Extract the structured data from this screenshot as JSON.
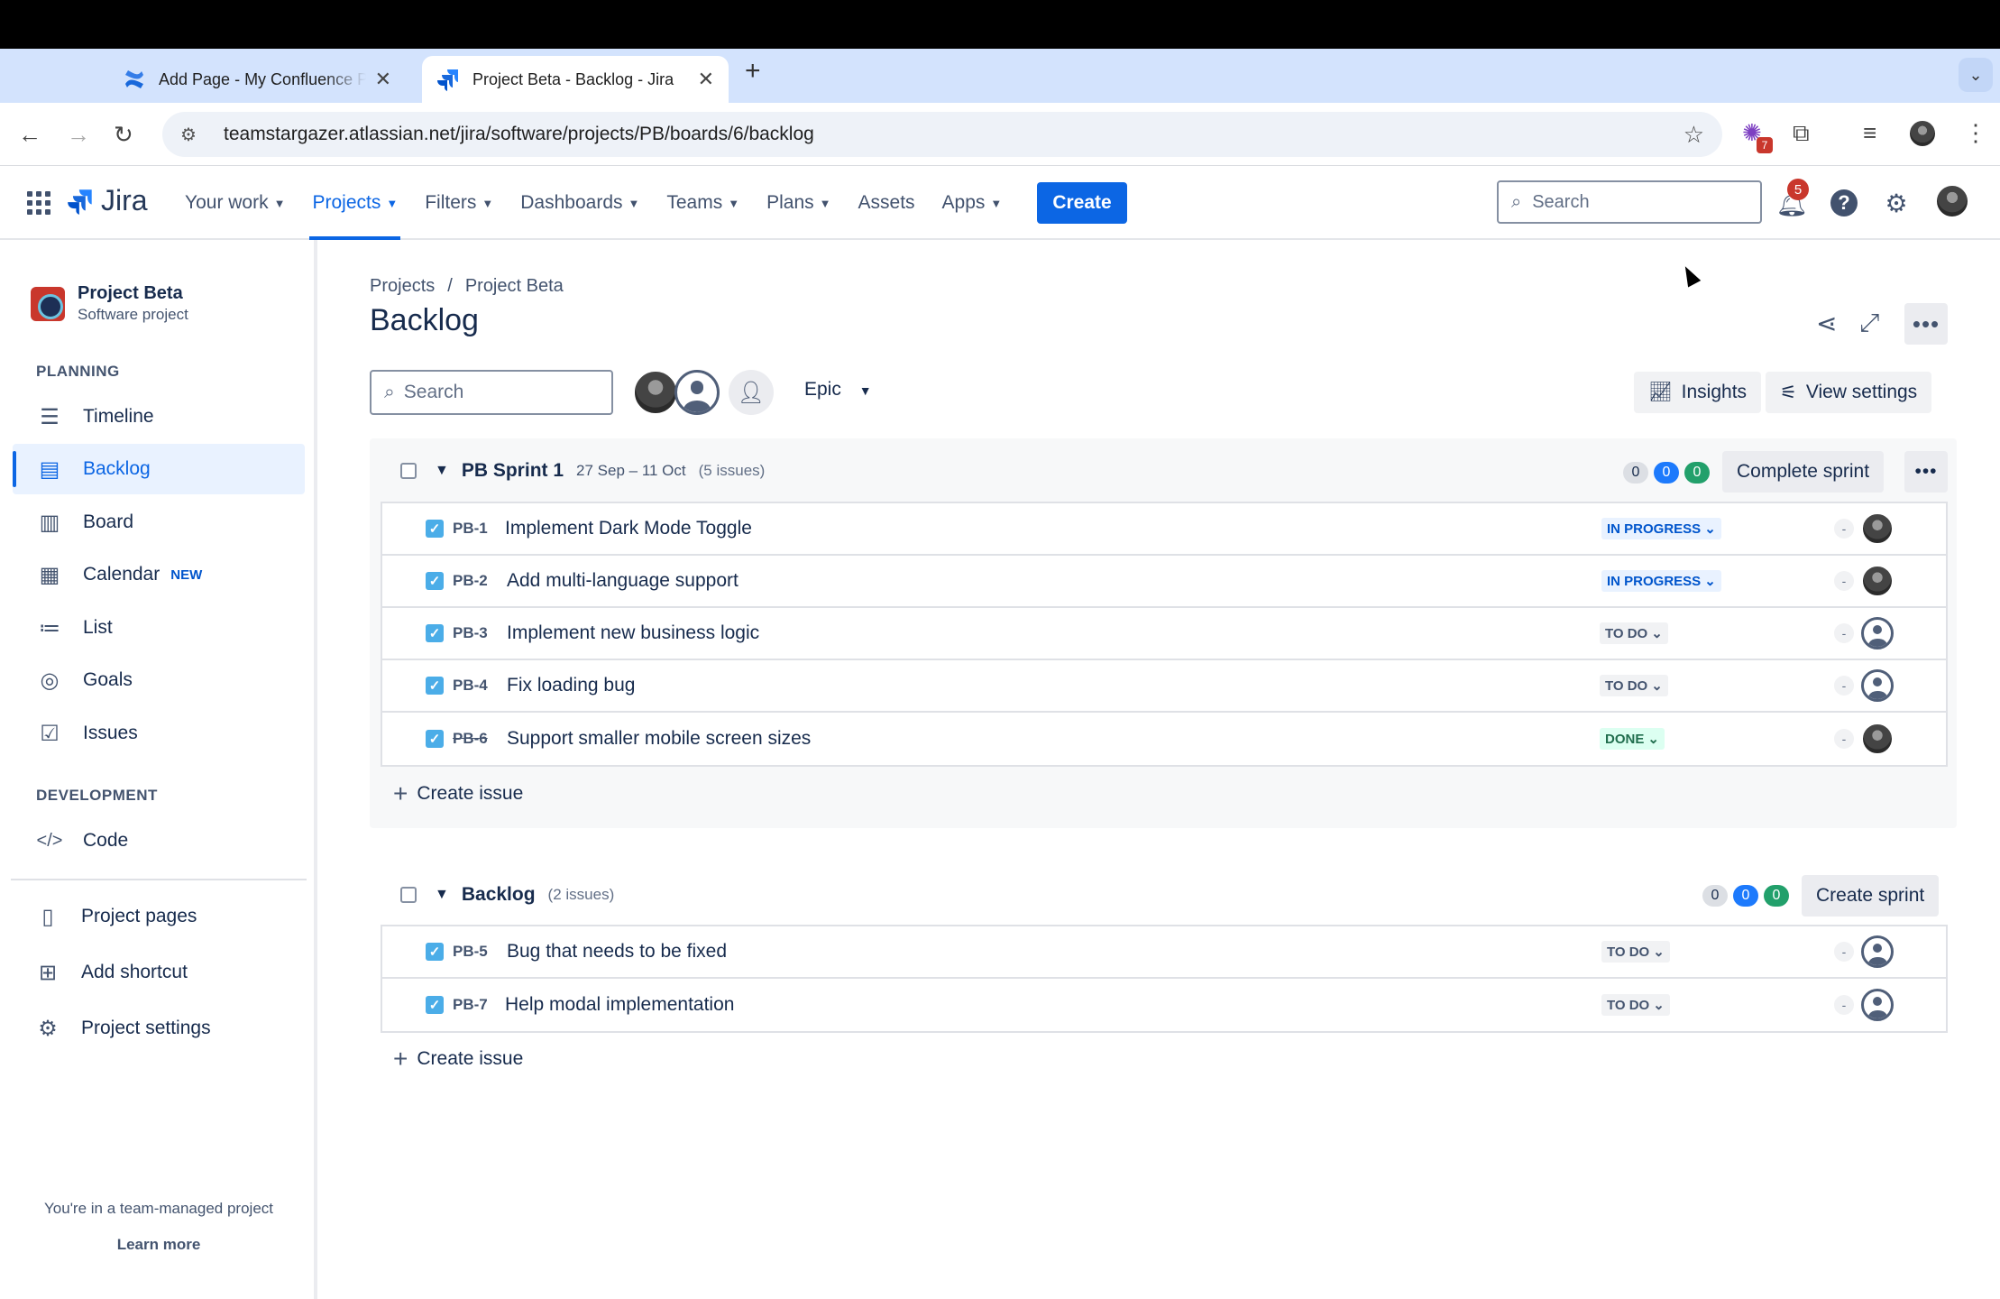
{
  "browser": {
    "tabs": [
      {
        "title": "Add Page - My Confluence Pa",
        "active": false
      },
      {
        "title": "Project Beta - Backlog - Jira",
        "active": true
      }
    ],
    "url": "teamstargazer.atlassian.net/jira/software/projects/PB/boards/6/backlog",
    "extension_badge": "7"
  },
  "header": {
    "logo": "Jira",
    "nav": [
      {
        "label": "Your work",
        "caret": true,
        "selected": false
      },
      {
        "label": "Projects",
        "caret": true,
        "selected": true
      },
      {
        "label": "Filters",
        "caret": true,
        "selected": false
      },
      {
        "label": "Dashboards",
        "caret": true,
        "selected": false
      },
      {
        "label": "Teams",
        "caret": true,
        "selected": false
      },
      {
        "label": "Plans",
        "caret": true,
        "selected": false
      },
      {
        "label": "Assets",
        "caret": false,
        "selected": false
      },
      {
        "label": "Apps",
        "caret": true,
        "selected": false
      }
    ],
    "create_label": "Create",
    "search_placeholder": "Search",
    "notification_count": "5"
  },
  "sidebar": {
    "project_name": "Project Beta",
    "project_type": "Software project",
    "planning_heading": "PLANNING",
    "planning_items": [
      {
        "label": "Timeline",
        "icon": "timeline-icon",
        "selected": false
      },
      {
        "label": "Backlog",
        "icon": "backlog-icon",
        "selected": true
      },
      {
        "label": "Board",
        "icon": "board-icon",
        "selected": false
      },
      {
        "label": "Calendar",
        "icon": "calendar-icon",
        "selected": false,
        "tag": "NEW"
      },
      {
        "label": "List",
        "icon": "list-icon",
        "selected": false
      },
      {
        "label": "Goals",
        "icon": "goals-icon",
        "selected": false
      },
      {
        "label": "Issues",
        "icon": "issues-icon",
        "selected": false
      }
    ],
    "development_heading": "DEVELOPMENT",
    "development_items": [
      {
        "label": "Code",
        "icon": "code-icon"
      }
    ],
    "bottom_items": [
      {
        "label": "Project pages",
        "icon": "pages-icon"
      },
      {
        "label": "Add shortcut",
        "icon": "add-shortcut-icon"
      },
      {
        "label": "Project settings",
        "icon": "gear-icon"
      }
    ],
    "footer_text": "You're in a team-managed project",
    "footer_link": "Learn more"
  },
  "main": {
    "breadcrumb": [
      "Projects",
      "/",
      "Project Beta"
    ],
    "title": "Backlog",
    "search_placeholder": "Search",
    "epic_label": "Epic",
    "insights_label": "Insights",
    "view_settings_label": "View settings",
    "sprint": {
      "name": "PB Sprint 1",
      "dates": "27 Sep – 11 Oct",
      "count": "(5 issues)",
      "counts": [
        "0",
        "0",
        "0"
      ],
      "action": "Complete sprint",
      "issues": [
        {
          "key": "PB-1",
          "summary": "Implement Dark Mode Toggle",
          "status": "IN PROGRESS",
          "kind": "ip",
          "done": false,
          "assignee": "photo"
        },
        {
          "key": "PB-2",
          "summary": "Add multi-language support",
          "status": "IN PROGRESS",
          "kind": "ip",
          "done": false,
          "assignee": "photo"
        },
        {
          "key": "PB-3",
          "summary": "Implement new business logic",
          "status": "TO DO",
          "kind": "todo",
          "done": false,
          "assignee": "blank"
        },
        {
          "key": "PB-4",
          "summary": "Fix loading bug",
          "status": "TO DO",
          "kind": "todo",
          "done": false,
          "assignee": "blank"
        },
        {
          "key": "PB-6",
          "summary": "Support smaller mobile screen sizes",
          "status": "DONE",
          "kind": "done",
          "done": true,
          "assignee": "photo"
        }
      ],
      "create_issue": "Create issue"
    },
    "backlog": {
      "name": "Backlog",
      "count": "(2 issues)",
      "counts": [
        "0",
        "0",
        "0"
      ],
      "action": "Create sprint",
      "issues": [
        {
          "key": "PB-5",
          "summary": "Bug that needs to be fixed",
          "status": "TO DO",
          "kind": "todo",
          "done": false,
          "assignee": "blank"
        },
        {
          "key": "PB-7",
          "summary": "Help modal implementation",
          "status": "TO DO",
          "kind": "todo",
          "done": false,
          "assignee": "blank"
        }
      ],
      "create_issue": "Create issue"
    },
    "estimate_placeholder": "-"
  },
  "colors": {
    "accent": "#0c66e4",
    "in_progress_bg": "#e9f2ff",
    "done_bg": "#dcfff1",
    "todo_bg": "#f1f2f4"
  }
}
